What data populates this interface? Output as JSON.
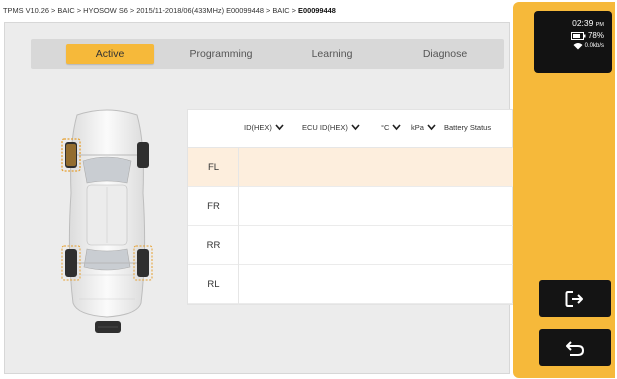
{
  "breadcrumb": {
    "path": "TPMS V10.26 > BAIC > HYOSOW S6 > 2015/11-2018/06(433MHz) E00099448 > BAIC > ",
    "current": "E00099448"
  },
  "tabs": [
    {
      "label": "Active",
      "active": true
    },
    {
      "label": "Programming",
      "active": false
    },
    {
      "label": "Learning",
      "active": false
    },
    {
      "label": "Diagnose",
      "active": false
    }
  ],
  "table": {
    "columns": [
      "ID(HEX)",
      "ECU ID(HEX)",
      "°C",
      "kPa",
      "Battery Status"
    ],
    "rows": [
      {
        "label": "FL",
        "selected": true
      },
      {
        "label": "FR",
        "selected": false
      },
      {
        "label": "RR",
        "selected": false
      },
      {
        "label": "RL",
        "selected": false
      }
    ]
  },
  "status": {
    "time": "02:39",
    "ampm": "PM",
    "battery": "78%",
    "wifi": "0.0kb/s"
  },
  "buttons": {
    "exit_icon": "exit-icon",
    "back_icon": "back-icon"
  },
  "colors": {
    "accent": "#f6b93a",
    "selected_row": "#fdeedd",
    "tire_highlight": "#e6a030"
  }
}
